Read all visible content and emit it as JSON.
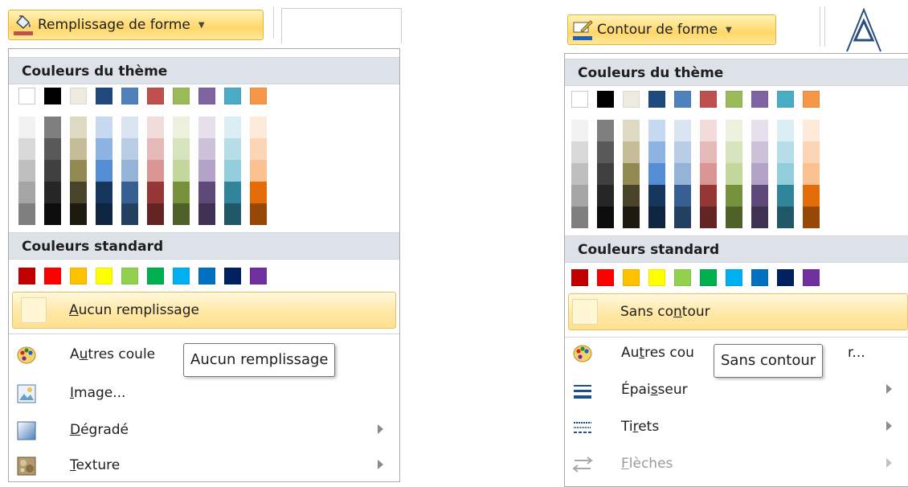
{
  "fill_menu": {
    "button_label": "Remplissage de forme",
    "theme_heading": "Couleurs du thème",
    "standard_heading": "Couleurs standard",
    "no_fill": {
      "before": "",
      "key": "A",
      "after": "ucun remplissage"
    },
    "more_colors": {
      "before": "A",
      "key": "u",
      "after": "tres coule"
    },
    "picture": {
      "before": "",
      "key": "I",
      "after": "mage..."
    },
    "gradient": {
      "before": "",
      "key": "D",
      "after": "égradé"
    },
    "texture": {
      "before": "",
      "key": "T",
      "after": "exture"
    },
    "tooltip": "Aucun remplissage"
  },
  "outline_menu": {
    "button_label": "Contour de forme",
    "theme_heading": "Couleurs du thème",
    "standard_heading": "Couleurs standard",
    "no_outline": {
      "before": "Sans co",
      "key": "n",
      "after": "tour"
    },
    "more_colors": {
      "before": "Au",
      "key": "t",
      "after": "res cou"
    },
    "more_colors_tail": "r...",
    "weight": {
      "before": "Épai",
      "key": "s",
      "after": "seur"
    },
    "dashes": {
      "before": "Ti",
      "key": "r",
      "after": "ets"
    },
    "arrows": {
      "before": "",
      "key": "F",
      "after": "lèches"
    },
    "tooltip": "Sans contour"
  },
  "colors": {
    "theme_top": [
      "#ffffff",
      "#000000",
      "#eeece1",
      "#1f497d",
      "#4f81bd",
      "#c0504d",
      "#9bbb59",
      "#8064a2",
      "#4bacc6",
      "#f79646"
    ],
    "theme_shades": [
      [
        "#f2f2f2",
        "#d8d8d8",
        "#bfbfbf",
        "#a5a5a5",
        "#7f7f7f"
      ],
      [
        "#7f7f7f",
        "#595959",
        "#3f3f3f",
        "#262626",
        "#0c0c0c"
      ],
      [
        "#ddd9c3",
        "#c4bd97",
        "#938953",
        "#494429",
        "#1d1b10"
      ],
      [
        "#c6d9f0",
        "#8db3e2",
        "#548dd4",
        "#17365d",
        "#0f243e"
      ],
      [
        "#dbe5f1",
        "#b8cce4",
        "#95b3d7",
        "#366092",
        "#244061"
      ],
      [
        "#f2dcdb",
        "#e5b9b7",
        "#d99694",
        "#953734",
        "#632423"
      ],
      [
        "#ebf1dd",
        "#d7e3bc",
        "#c3d69b",
        "#76923c",
        "#4f6128"
      ],
      [
        "#e5e0ec",
        "#ccc1d9",
        "#b2a2c7",
        "#5f497a",
        "#3f3151"
      ],
      [
        "#dbeef3",
        "#b7dde8",
        "#92cddc",
        "#31859b",
        "#205867"
      ],
      [
        "#fdeada",
        "#fbd5b5",
        "#fac08f",
        "#e36c09",
        "#974806"
      ]
    ],
    "standard": [
      "#c00000",
      "#ff0000",
      "#ffc000",
      "#ffff00",
      "#92d050",
      "#00b050",
      "#00b0f0",
      "#0070c0",
      "#002060",
      "#7030a0"
    ],
    "fill_bar": "#c0504d",
    "outline_bar": "#1f5fbf",
    "highlight": "#ffe8a6"
  }
}
